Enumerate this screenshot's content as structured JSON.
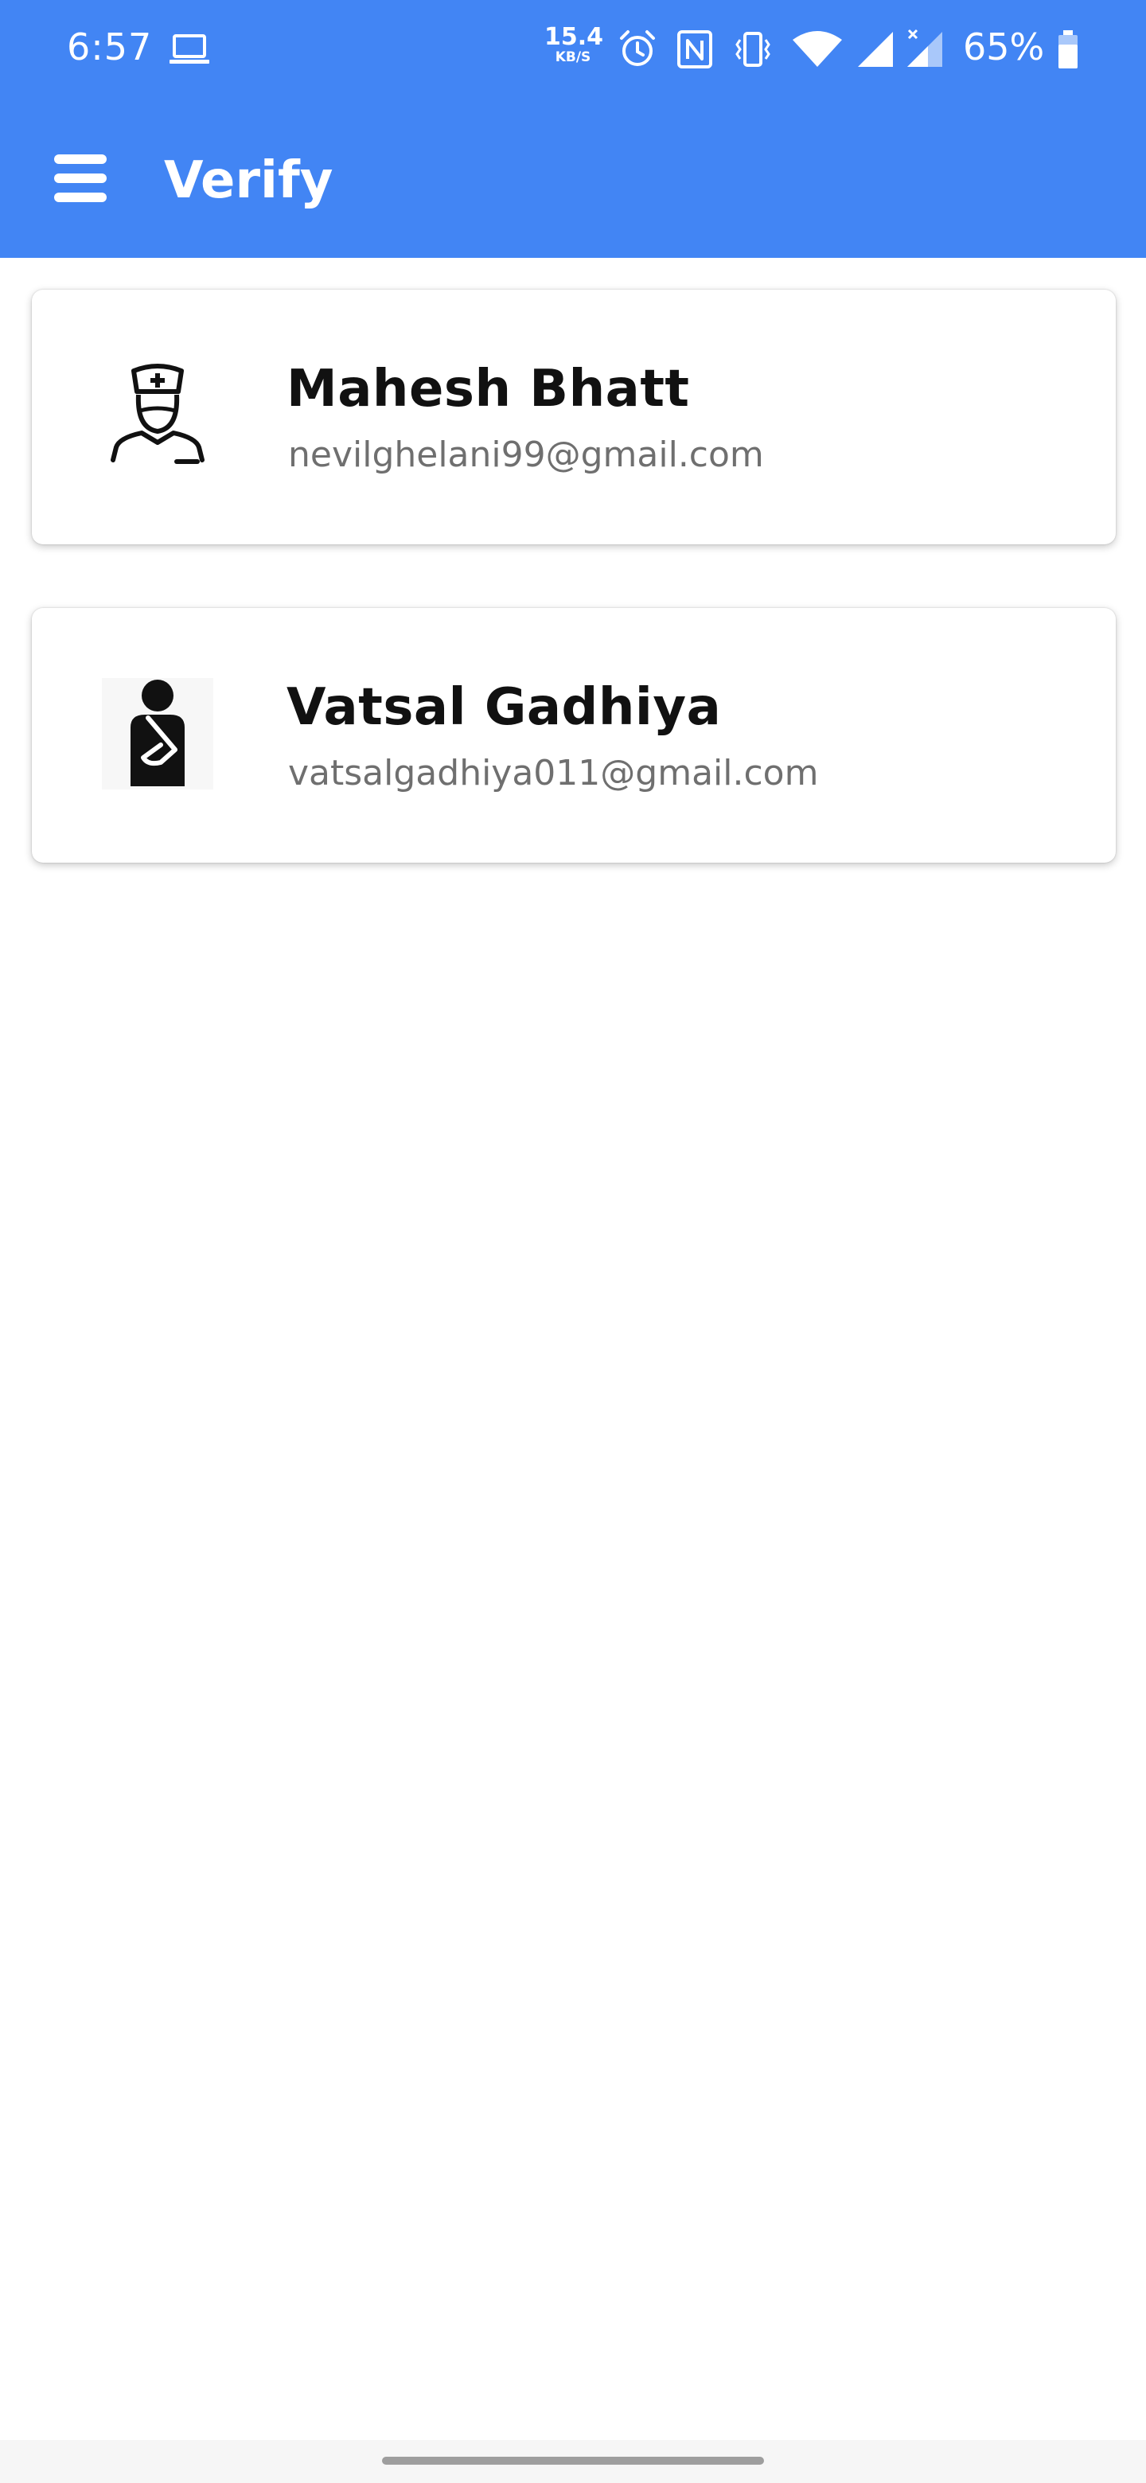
{
  "status_bar": {
    "time": "6:57",
    "net_speed_value": "15.4",
    "net_speed_unit": "KB/S",
    "battery_percent": "65%",
    "icons": [
      "laptop-icon",
      "alarm-icon",
      "nfc-icon",
      "vibrate-icon",
      "wifi-icon",
      "signal-icon",
      "signal-no-data-icon",
      "battery-icon"
    ]
  },
  "app_bar": {
    "title": "Verify",
    "menu_icon": "menu-icon",
    "color": "#4285f4"
  },
  "users": [
    {
      "name": "Mahesh Bhatt",
      "email": "nevilghelani99@gmail.com",
      "avatar_icon": "nurse-icon"
    },
    {
      "name": "Vatsal Gadhiya",
      "email": "vatsalgadhiya011@gmail.com",
      "avatar_icon": "patient-sling-icon"
    }
  ]
}
